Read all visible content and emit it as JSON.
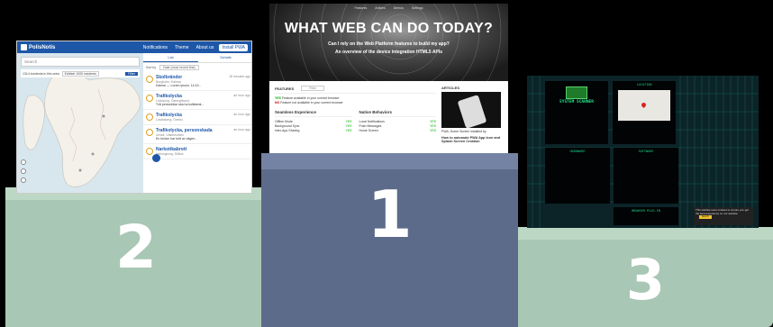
{
  "podium": {
    "ranks": [
      "1",
      "2",
      "3"
    ]
  },
  "shot2": {
    "app_name": "PolisNotis",
    "nav": [
      "Notifications",
      "Theme",
      "About us"
    ],
    "install_label": "Install PWA",
    "search_placeholder": "Search",
    "filter_text": "1314 incidents in this area",
    "filter_select": "Edit/set 1000 incidents",
    "filter_button": "Filter",
    "tabs": [
      "List",
      "Details"
    ],
    "sort_label": "Sort by",
    "sort_value": "Date (most recent first)",
    "items": [
      {
        "title": "Skolbränder",
        "location": "Borgholm, Kalmar",
        "time": "18 minutes ago",
        "desc": "Kalmar — Lorem ipsum, 14:19..."
      },
      {
        "title": "Trafikolycka",
        "location": "Linköping, Östergötland",
        "time": "an hour ago",
        "desc": "Två personbilar ska ha kolliderat..."
      },
      {
        "title": "Trafikolycka",
        "location": "Lindesberg, Örebro",
        "time": "an hour ago",
        "desc": ""
      },
      {
        "title": "Trafikolycka, personskada",
        "location": "Umeå, Västerbotten",
        "time": "an hour ago",
        "desc": "En fordon har kört av vägen..."
      },
      {
        "title": "Narkotikabrott",
        "location": "Helsingborg, Skåne",
        "time": "",
        "desc": ""
      }
    ]
  },
  "shot1": {
    "nav": [
      "Features",
      "Articles",
      "Demos",
      "Settings"
    ],
    "headline": "WHAT WEB CAN DO TODAY?",
    "sub1": "Can I rely on the Web Platform features to build my app?",
    "sub2": "An overview of the device integration HTML5 APIs",
    "features_heading": "FEATURES",
    "filter_placeholder": "Filter",
    "legend_yes_mark": "YES",
    "legend_yes": "Feature available in your current browser",
    "legend_no_mark": "NO",
    "legend_no": "Feature not available in your current browser",
    "col1_title": "Seamless Experience",
    "col1_rows": [
      {
        "label": "Offline Mode",
        "val": "YES"
      },
      {
        "label": "Background Sync",
        "val": "YES"
      },
      {
        "label": "Inter-App Sharing",
        "val": "YES"
      }
    ],
    "col2_title": "Native Behaviors",
    "col2_rows": [
      {
        "label": "Local Notifications",
        "val": "YES"
      },
      {
        "label": "Push Messages",
        "val": "YES"
      },
      {
        "label": "Home Screen",
        "val": "YES"
      }
    ],
    "articles_heading": "ARTICLES",
    "article_caption": "PWA, Home Screen installed by",
    "article_title": "How to automate PWA App Icon and Splash Screen Creation"
  },
  "shot3": {
    "title": "SYSTEM SCANNER",
    "location_head": "LOCATION",
    "hardware_head": "HARDWARE",
    "software_head": "SOFTWARE",
    "browser_head": "BROWSER PLUG-IN",
    "cookie_text": "This website uses cookies to ensure you get the best experience on our website.",
    "cookie_button": "Got it!"
  }
}
